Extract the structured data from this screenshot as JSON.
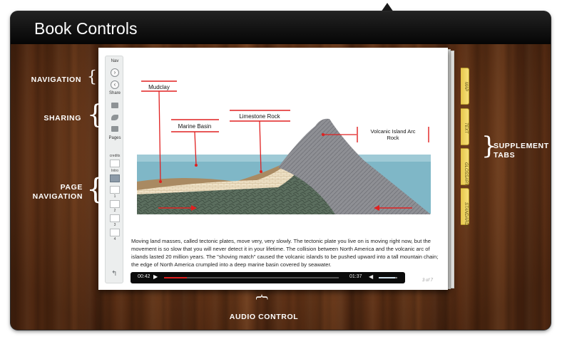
{
  "window": {
    "title": "Book Controls"
  },
  "annotations": {
    "navigation": "NAVIGATION",
    "sharing": "SHARING",
    "page_navigation_line1": "PAGE",
    "page_navigation_line2": "NAVIGATION",
    "supplement_line1": "SUPPLEMENT",
    "supplement_line2": "TABS",
    "audio_control": "AUDIO CONTROL"
  },
  "sidebar": {
    "nav_label": "Nav",
    "share_label": "Share",
    "pages_label": "Pages",
    "thumbs": [
      {
        "label": "credits",
        "active": false
      },
      {
        "label": "Intro",
        "active": true
      },
      {
        "label": "1",
        "active": false
      },
      {
        "label": "2",
        "active": false
      },
      {
        "label": "3",
        "active": false
      },
      {
        "label": "4",
        "active": false
      }
    ]
  },
  "tabs": [
    "MAP",
    "TEXT",
    "GLOSSARY",
    "STANDARDS"
  ],
  "diagram": {
    "labels": {
      "mudclay": "Mudclay",
      "marine_basin": "Marine Basin",
      "limestone_rock": "Limestone Rock",
      "volcanic_line1": "Volcanic Island Arc",
      "volcanic_line2": "Rock"
    }
  },
  "caption": "Moving land masses, called tectonic plates, move very, very slowly. The tectonic plate you live on is moving right now, but the movement is so slow that you will never detect it in your lifetime. The collision between North America and the volcanic arc of islands lasted 20 million years. The \"shoving match\" caused the volcanic islands to be pushed upward into a tall mountain chain; the edge of North America crumpled into a deep marine basin covered by seawater.",
  "audio": {
    "elapsed": "00:42",
    "total": "01:37",
    "progress": 0.13,
    "volume": 0.9
  },
  "page_indicator": "3 of 7",
  "colors": {
    "accent": "#e02020",
    "tab_yellow": "#f0d45a",
    "sidebar_active": "#8c9aa8"
  }
}
